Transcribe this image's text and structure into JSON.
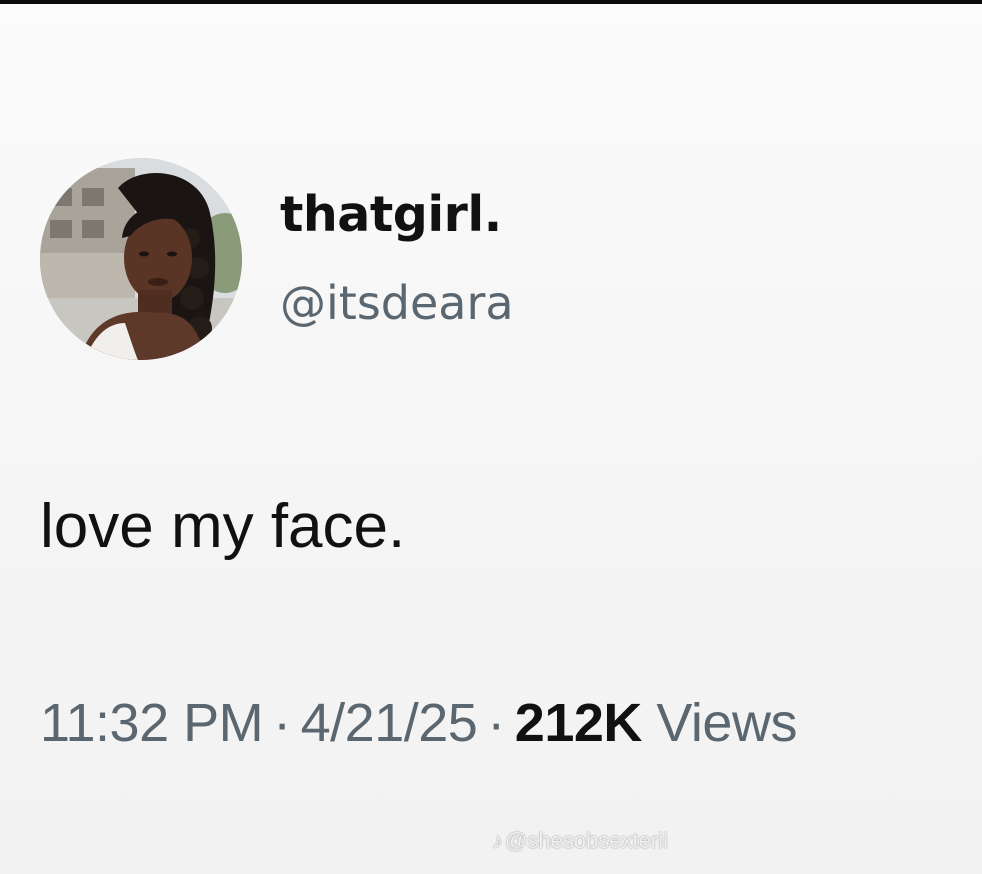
{
  "tweet": {
    "display_name": "thatgirl.",
    "handle": "@itsdeara",
    "text": "love my face.",
    "time": "11:32 PM",
    "date": "4/21/25",
    "views_count": "212K",
    "views_label": "Views",
    "separator": "·"
  },
  "watermark": {
    "icon": "tiktok-icon",
    "text": "@shesobsexterii"
  },
  "colors": {
    "top_bar": "#0b0b0b",
    "background": "#f6f6f6",
    "text": "#111111",
    "secondary_text": "#5b6770"
  }
}
